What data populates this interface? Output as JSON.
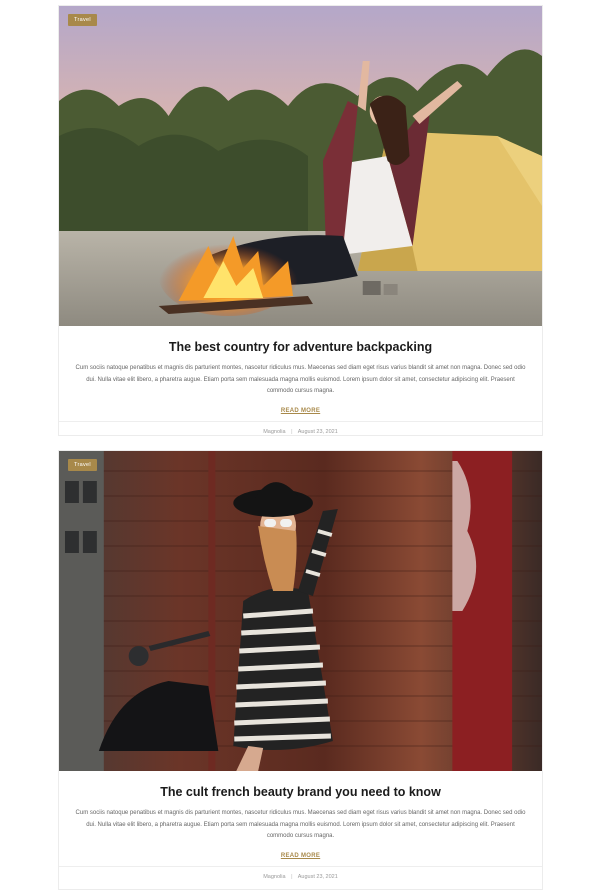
{
  "posts": [
    {
      "category": "Travel",
      "title": "The best country for adventure backpacking",
      "excerpt": "Cum sociis natoque penatibus et magnis dis parturient montes, nascetur ridiculus mus. Maecenas sed diam eget risus varius blandit sit amet non magna. Donec sed odio dui. Nulla vitae elit libero, a pharetra augue. Etiam porta sem malesuada magna mollis euismod. Lorem ipsum dolor sit amet, consectetur adipiscing elit. Praesent commodo cursus magna.",
      "read_more": "READ MORE",
      "author": "Magnolia",
      "date": "August 23, 2021"
    },
    {
      "category": "Travel",
      "title": "The cult french beauty brand you need to know",
      "excerpt": "Cum sociis natoque penatibus et magnis dis parturient montes, nascetur ridiculus mus. Maecenas sed diam eget risus varius blandit sit amet non magna. Donec sed odio dui. Nulla vitae elit libero, a pharetra augue. Etiam porta sem malesuada magna mollis euismod. Lorem ipsum dolor sit amet, consectetur adipiscing elit. Praesent commodo cursus magna.",
      "read_more": "READ MORE",
      "author": "Magnolia",
      "date": "August 23, 2021"
    }
  ],
  "meta_separator": "|",
  "colors": {
    "accent": "#a8894a",
    "title": "#1b1b1b",
    "text": "#666666",
    "meta": "#999999"
  }
}
